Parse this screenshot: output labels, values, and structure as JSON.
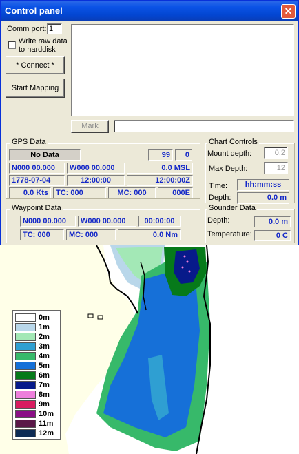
{
  "window": {
    "title": "Control panel",
    "close_glyph": "✕"
  },
  "connection": {
    "comm_port_label": "Comm port:",
    "comm_port_value": "1",
    "write_raw_label": "Write raw data to harddisk",
    "connect_button": "* Connect *",
    "start_mapping_button": "Start Mapping",
    "mark_button": "Mark"
  },
  "gps": {
    "title": "GPS Data",
    "status": "No Data",
    "satellites": "99",
    "fix": "0",
    "lat": "N000 00.000",
    "lon": "W000 00.000",
    "altitude": "0.0 MSL",
    "date": "1778-07-04",
    "local_time": "12:00:00",
    "utc_time": "12:00:00Z",
    "speed": "0.0 Kts",
    "true_course": "TC: 000",
    "magnetic_course": "MC: 000",
    "variation": "000E"
  },
  "chart_controls": {
    "title": "Chart Controls",
    "mount_depth_label": "Mount depth:",
    "mount_depth_value": "0.2",
    "max_depth_label": "Max Depth:",
    "max_depth_value": "12",
    "time_label": "Time:",
    "time_value": "hh:mm:ss",
    "depth_label": "Depth:",
    "depth_value": "0.0 m"
  },
  "waypoint": {
    "title": "Waypoint Data",
    "lat": "N000 00.000",
    "lon": "W000 00.000",
    "eta": "00:00:00",
    "true_course": "TC: 000",
    "magnetic_course": "MC: 000",
    "distance": "0.0 Nm"
  },
  "sounder": {
    "title": "Sounder Data",
    "depth_label": "Depth:",
    "depth_value": "0.0 m",
    "temperature_label": "Temperature:",
    "temperature_value": "0 C"
  },
  "legend": [
    {
      "label": "0m",
      "color": "#ffffff"
    },
    {
      "label": "1m",
      "color": "#b9d7ea"
    },
    {
      "label": "2m",
      "color": "#a3e8b6"
    },
    {
      "label": "3m",
      "color": "#2f9fd2"
    },
    {
      "label": "4m",
      "color": "#37b96a"
    },
    {
      "label": "5m",
      "color": "#1670d8"
    },
    {
      "label": "6m",
      "color": "#067a1a"
    },
    {
      "label": "7m",
      "color": "#071a8a"
    },
    {
      "label": "8m",
      "color": "#ee7fdc"
    },
    {
      "label": "9m",
      "color": "#d81c60"
    },
    {
      "label": "10m",
      "color": "#8a0f86"
    },
    {
      "label": "11m",
      "color": "#5a1848"
    },
    {
      "label": "12m",
      "color": "#0d2b55"
    }
  ]
}
